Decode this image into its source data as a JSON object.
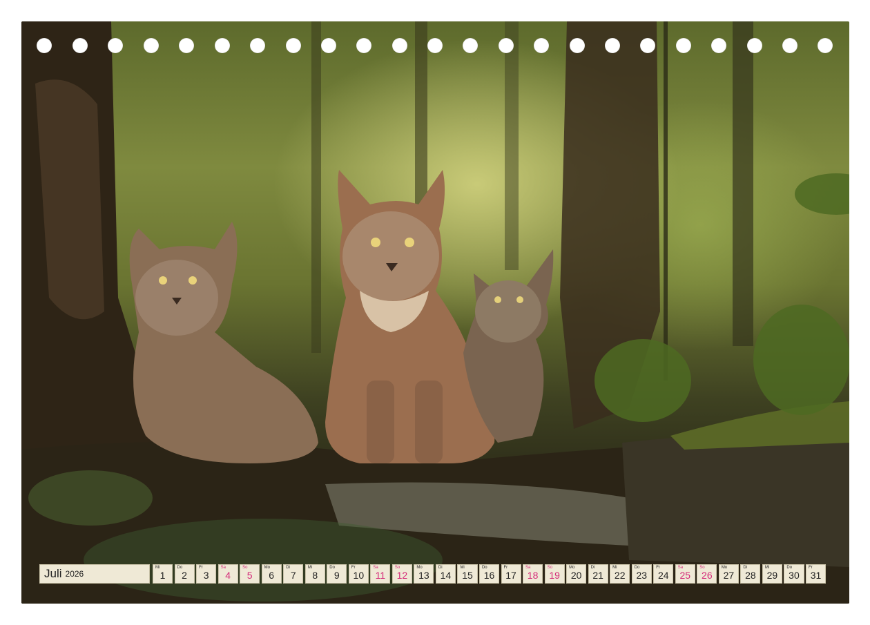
{
  "calendar": {
    "month": "Juli",
    "year": "2026",
    "days": [
      {
        "wd": "Mi",
        "n": "1",
        "we": false
      },
      {
        "wd": "Do",
        "n": "2",
        "we": false
      },
      {
        "wd": "Fr",
        "n": "3",
        "we": false
      },
      {
        "wd": "Sa",
        "n": "4",
        "we": true
      },
      {
        "wd": "So",
        "n": "5",
        "we": true
      },
      {
        "wd": "Mo",
        "n": "6",
        "we": false
      },
      {
        "wd": "Di",
        "n": "7",
        "we": false
      },
      {
        "wd": "Mi",
        "n": "8",
        "we": false
      },
      {
        "wd": "Do",
        "n": "9",
        "we": false
      },
      {
        "wd": "Fr",
        "n": "10",
        "we": false
      },
      {
        "wd": "Sa",
        "n": "11",
        "we": true
      },
      {
        "wd": "So",
        "n": "12",
        "we": true
      },
      {
        "wd": "Mo",
        "n": "13",
        "we": false
      },
      {
        "wd": "Di",
        "n": "14",
        "we": false
      },
      {
        "wd": "Mi",
        "n": "15",
        "we": false
      },
      {
        "wd": "Do",
        "n": "16",
        "we": false
      },
      {
        "wd": "Fr",
        "n": "17",
        "we": false
      },
      {
        "wd": "Sa",
        "n": "18",
        "we": true
      },
      {
        "wd": "So",
        "n": "19",
        "we": true
      },
      {
        "wd": "Mo",
        "n": "20",
        "we": false
      },
      {
        "wd": "Di",
        "n": "21",
        "we": false
      },
      {
        "wd": "Mi",
        "n": "22",
        "we": false
      },
      {
        "wd": "Do",
        "n": "23",
        "we": false
      },
      {
        "wd": "Fr",
        "n": "24",
        "we": false
      },
      {
        "wd": "Sa",
        "n": "25",
        "we": true
      },
      {
        "wd": "So",
        "n": "26",
        "we": true
      },
      {
        "wd": "Mo",
        "n": "27",
        "we": false
      },
      {
        "wd": "Di",
        "n": "28",
        "we": false
      },
      {
        "wd": "Mi",
        "n": "29",
        "we": false
      },
      {
        "wd": "Do",
        "n": "30",
        "we": false
      },
      {
        "wd": "Fr",
        "n": "31",
        "we": false
      }
    ]
  },
  "colors": {
    "weekend": "#d42a78",
    "cell_bg": "#efe9d6"
  },
  "photo": {
    "subject": "lynx-family-in-forest-illustration"
  }
}
